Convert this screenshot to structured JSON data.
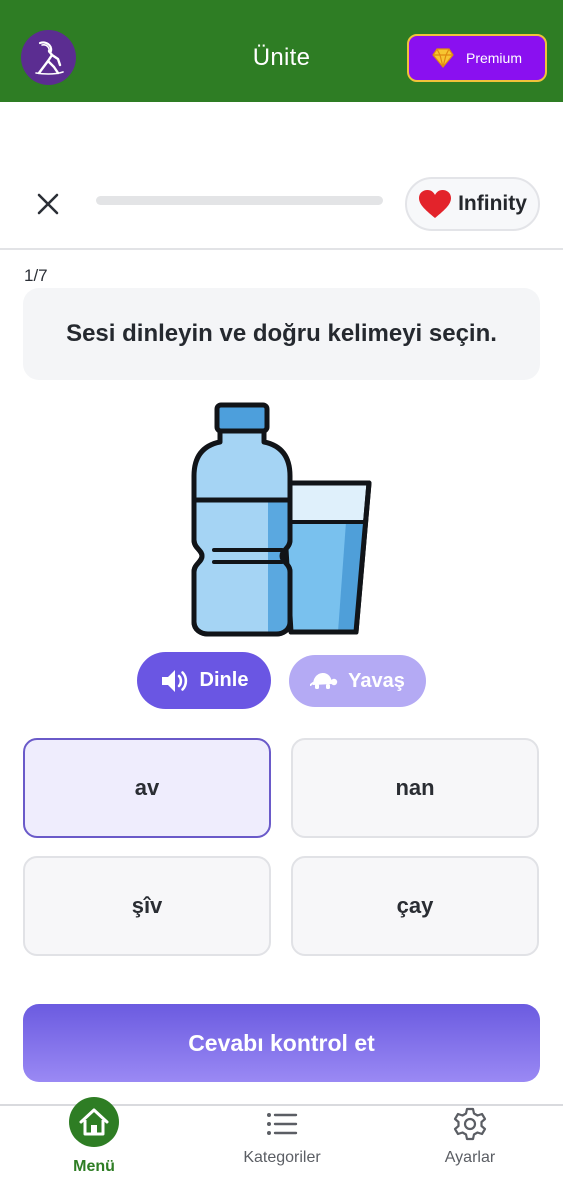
{
  "header": {
    "title": "Ünite",
    "premium_label": "Premium"
  },
  "lesson": {
    "progress": 0,
    "lives_label": "Infinity",
    "counter": "1/7",
    "prompt": "Sesi dinleyin ve doğru kelimeyi seçin.",
    "image_icon": "water-bottle-and-glass",
    "listen_label": "Dinle",
    "slow_label": "Yavaş",
    "options": [
      {
        "label": "av",
        "selected": true
      },
      {
        "label": "nan",
        "selected": false
      },
      {
        "label": "şîv",
        "selected": false
      },
      {
        "label": "çay",
        "selected": false
      }
    ],
    "check_label": "Cevabı kontrol et"
  },
  "nav": {
    "items": [
      {
        "label": "Menü",
        "icon": "home-icon",
        "active": true
      },
      {
        "label": "Kategoriler",
        "icon": "list-icon",
        "active": false
      },
      {
        "label": "Ayarlar",
        "icon": "gear-icon",
        "active": false
      }
    ]
  },
  "colors": {
    "header_green": "#2e7d24",
    "accent_purple": "#6a56e3",
    "premium_purple": "#8a10f0",
    "heart_red": "#e3232b"
  }
}
